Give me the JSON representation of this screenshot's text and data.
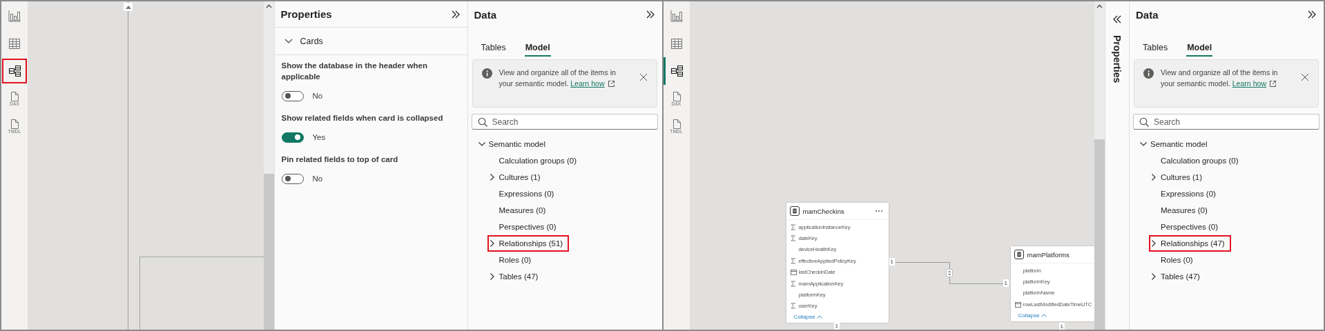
{
  "left_view": {
    "rail": {
      "indicator": false,
      "items": [
        {
          "kind": "report",
          "selected": false,
          "highlighted": false
        },
        {
          "kind": "table",
          "selected": false,
          "highlighted": false
        },
        {
          "kind": "model",
          "selected": true,
          "highlighted": true
        },
        {
          "kind": "dax",
          "label": "DAX",
          "selected": false,
          "highlighted": false
        },
        {
          "kind": "tmdl",
          "label": "TMDL",
          "selected": false,
          "highlighted": false
        }
      ]
    },
    "canvas": {
      "kind": "report"
    },
    "properties": {
      "title": "Properties",
      "collapsed": false,
      "section": {
        "title": "Cards",
        "expanded": true
      },
      "settings": [
        {
          "label": "Show the database in the header when applicable",
          "on": false,
          "value_text": "No"
        },
        {
          "label": "Show related fields when card is collapsed",
          "on": true,
          "value_text": "Yes"
        },
        {
          "label": "Pin related fields to top of card",
          "on": false,
          "value_text": "No"
        }
      ]
    },
    "data": {
      "title": "Data",
      "tabs": [
        {
          "label": "Tables",
          "selected": false
        },
        {
          "label": "Model",
          "selected": true
        }
      ],
      "info": {
        "text": "View and organize all of the items in your semantic model.",
        "link": "Learn how"
      },
      "search": {
        "placeholder": "Search"
      },
      "tree": [
        {
          "label": "Semantic model",
          "expanded": true,
          "highlighted": false,
          "children": [
            {
              "label": "Calculation groups (0)",
              "highlighted": false
            },
            {
              "label": "Cultures (1)",
              "expanded": false,
              "highlighted": false
            },
            {
              "label": "Expressions (0)",
              "highlighted": false
            },
            {
              "label": "Measures (0)",
              "highlighted": false
            },
            {
              "label": "Perspectives (0)",
              "highlighted": false
            },
            {
              "label": "Relationships (51)",
              "expanded": false,
              "highlighted": true
            },
            {
              "label": "Roles (0)",
              "highlighted": false
            },
            {
              "label": "Tables (47)",
              "expanded": false,
              "highlighted": false
            }
          ]
        }
      ]
    }
  },
  "right_view": {
    "rail": {
      "indicator": true,
      "items": [
        {
          "kind": "report",
          "selected": false,
          "highlighted": false
        },
        {
          "kind": "table",
          "selected": false,
          "highlighted": false
        },
        {
          "kind": "model",
          "selected": true,
          "highlighted": false
        },
        {
          "kind": "dax",
          "label": "DAX",
          "selected": false,
          "highlighted": false
        },
        {
          "kind": "tmdl",
          "label": "TMDL",
          "selected": false,
          "highlighted": false
        }
      ]
    },
    "canvas": {
      "kind": "diagram",
      "tables": [
        {
          "name": "mamCheckins",
          "more_menu": true,
          "footer": "Collapse",
          "bottom_label": "1",
          "fields": [
            {
              "name": "applicationInstanceKey",
              "kind": "sum"
            },
            {
              "name": "dateKey",
              "kind": "sum"
            },
            {
              "name": "deviceHealthKey",
              "kind": "plain"
            },
            {
              "name": "effectiveAppliedPolicyKey",
              "kind": "sum"
            },
            {
              "name": "lastCheckinDate",
              "kind": "date"
            },
            {
              "name": "mamApplicationKey",
              "kind": "sum"
            },
            {
              "name": "platformKey",
              "kind": "plain"
            },
            {
              "name": "userKey",
              "kind": "sum"
            }
          ]
        },
        {
          "name": "mamPlatforms",
          "more_menu": false,
          "footer": "Collapse",
          "bottom_label": "1",
          "fields": [
            {
              "name": "platform",
              "kind": "plain"
            },
            {
              "name": "platformKey",
              "kind": "plain"
            },
            {
              "name": "platformName",
              "kind": "plain"
            },
            {
              "name": "rowLastModifiedDateTimeUTC",
              "kind": "date"
            }
          ]
        }
      ],
      "relationships": [
        {
          "from_label": "1",
          "to_label": "1"
        }
      ]
    },
    "properties": {
      "title": "Properties",
      "collapsed": true
    },
    "data": {
      "title": "Data",
      "tabs": [
        {
          "label": "Tables",
          "selected": false
        },
        {
          "label": "Model",
          "selected": true
        }
      ],
      "info": {
        "text": "View and organize all of the items in your semantic model.",
        "link": "Learn how"
      },
      "search": {
        "placeholder": "Search"
      },
      "tree": [
        {
          "label": "Semantic model",
          "expanded": true,
          "highlighted": false,
          "children": [
            {
              "label": "Calculation groups (0)",
              "highlighted": false
            },
            {
              "label": "Cultures (1)",
              "expanded": false,
              "highlighted": false
            },
            {
              "label": "Expressions (0)",
              "highlighted": false
            },
            {
              "label": "Measures (0)",
              "highlighted": false
            },
            {
              "label": "Perspectives (0)",
              "highlighted": false
            },
            {
              "label": "Relationships (47)",
              "expanded": false,
              "highlighted": true
            },
            {
              "label": "Roles (0)",
              "highlighted": false
            },
            {
              "label": "Tables (47)",
              "expanded": false,
              "highlighted": false
            }
          ]
        }
      ]
    }
  }
}
